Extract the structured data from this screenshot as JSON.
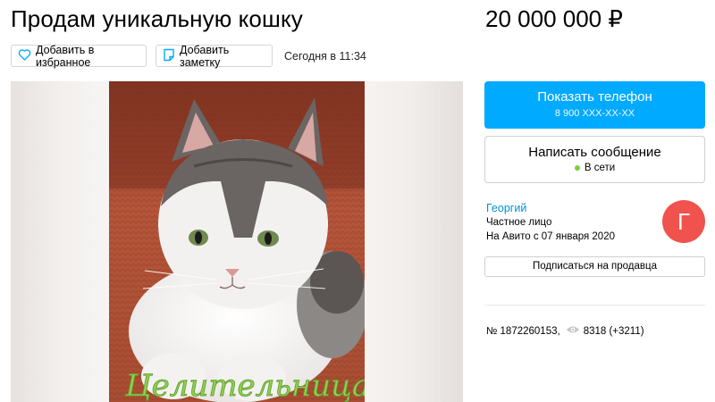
{
  "listing": {
    "title": "Продам уникальную кошку",
    "price": "20 000 000 ₽",
    "favorite_label": "Добавить в избранное",
    "note_label": "Добавить заметку",
    "date": "Сегодня в 11:34",
    "photo_caption": "Целительница"
  },
  "contact": {
    "phone_label": "Показать телефон",
    "phone_masked": "8 900 XXX-XX-XX",
    "message_label": "Написать сообщение",
    "online_status": "В сети"
  },
  "seller": {
    "name": "Георгий",
    "type": "Частное лицо",
    "since": "На Авито с 07 января 2020",
    "avatar_letter": "Г",
    "subscribe_label": "Подписаться на продавца"
  },
  "stats": {
    "ad_number": "№ 1872260153,",
    "views": "8318 (+3211)"
  },
  "colors": {
    "accent": "#00aaff",
    "link": "#0091d9",
    "avatar": "#f0524e",
    "online": "#7ccf3c",
    "caption": "#8fd14f"
  }
}
